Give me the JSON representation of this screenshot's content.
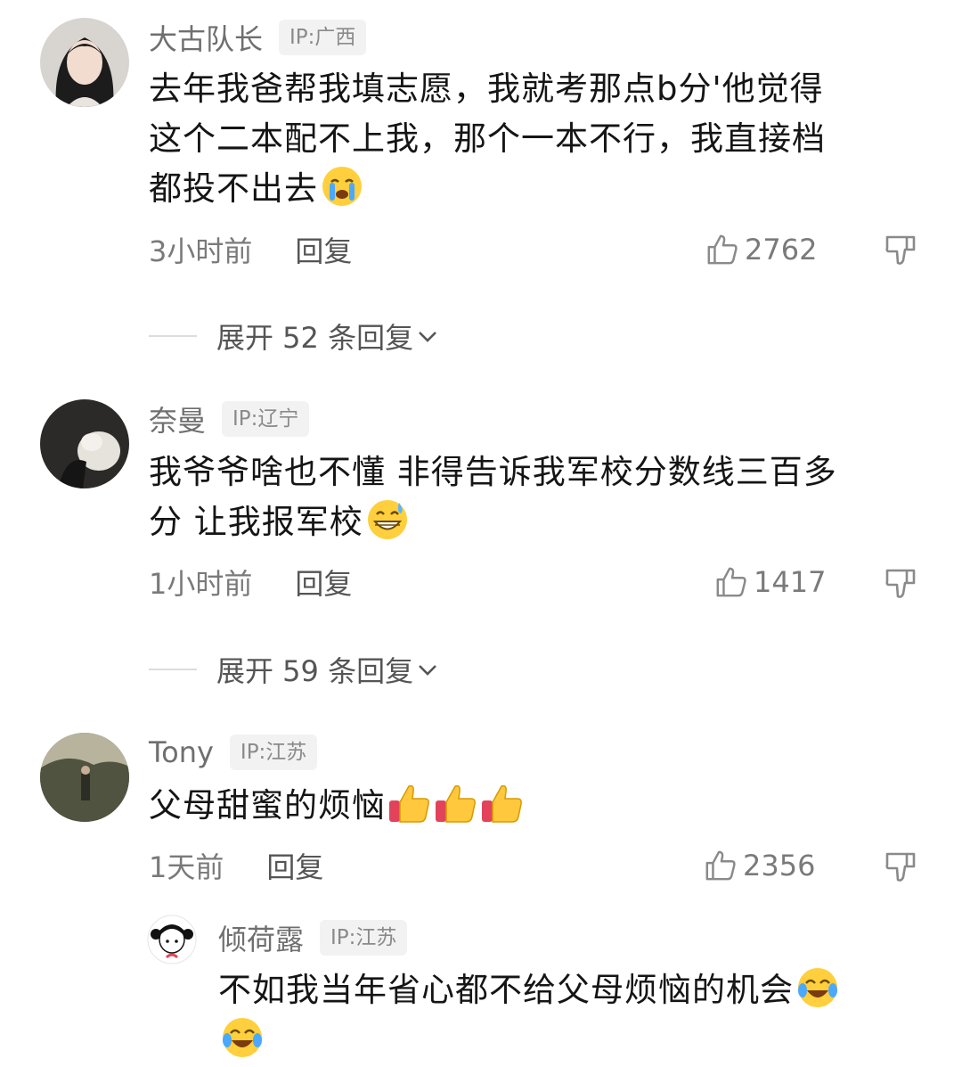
{
  "comments": [
    {
      "username": "大古队长",
      "ip": "IP:广西",
      "lines": [
        "去年我爸帮我填志愿，我就考那点b分'他觉得",
        "这个二本配不上我，那个一本不行，我直接档",
        "都投不出去"
      ],
      "emoji": "loudly-crying-face",
      "time": "3小时前",
      "reply_label": "回复",
      "likes": "2762",
      "expand_text": "展开 52 条回复"
    },
    {
      "username": "奈曼",
      "ip": "IP:辽宁",
      "lines": [
        "我爷爷啥也不懂 非得告诉我军校分数线三百多",
        "分 让我报军校"
      ],
      "emoji": "grinning-sweat-face",
      "time": "1小时前",
      "reply_label": "回复",
      "likes": "1417",
      "expand_text": "展开 59 条回复"
    },
    {
      "username": "Tony",
      "ip": "IP:江苏",
      "lines": [
        "父母甜蜜的烦恼"
      ],
      "emoji": "thumbs-up-x3",
      "time": "1天前",
      "reply_label": "回复",
      "likes": "2356"
    }
  ],
  "sub_reply": {
    "username": "倾荷露",
    "ip": "IP:江苏",
    "lines": [
      "不如我当年省心都不给父母烦恼的机会",
      ""
    ],
    "emoji": "face-with-tears-of-joy"
  }
}
